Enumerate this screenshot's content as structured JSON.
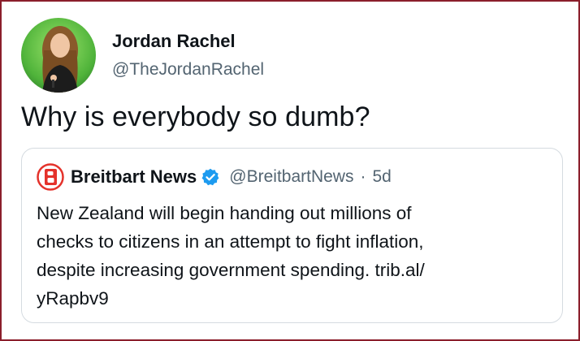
{
  "author": {
    "display_name": "Jordan Rachel",
    "handle": "@TheJordanRachel"
  },
  "tweet": {
    "text": "Why is everybody so dumb?"
  },
  "quoted_tweet": {
    "display_name": "Breitbart News",
    "verified_icon": "verified-badge-icon",
    "handle": "@BreitbartNews",
    "separator": "·",
    "time": "5d",
    "text": "New Zealand will begin handing out millions of\nchecks to citizens in an attempt to fight inflation,\ndespite increasing government spending. trib.al/\nyRapbv9"
  },
  "colors": {
    "frame_border": "#8b1e2b",
    "brand_red": "#e4322b",
    "verified_blue": "#1d9bf0",
    "muted_text": "#536471"
  }
}
